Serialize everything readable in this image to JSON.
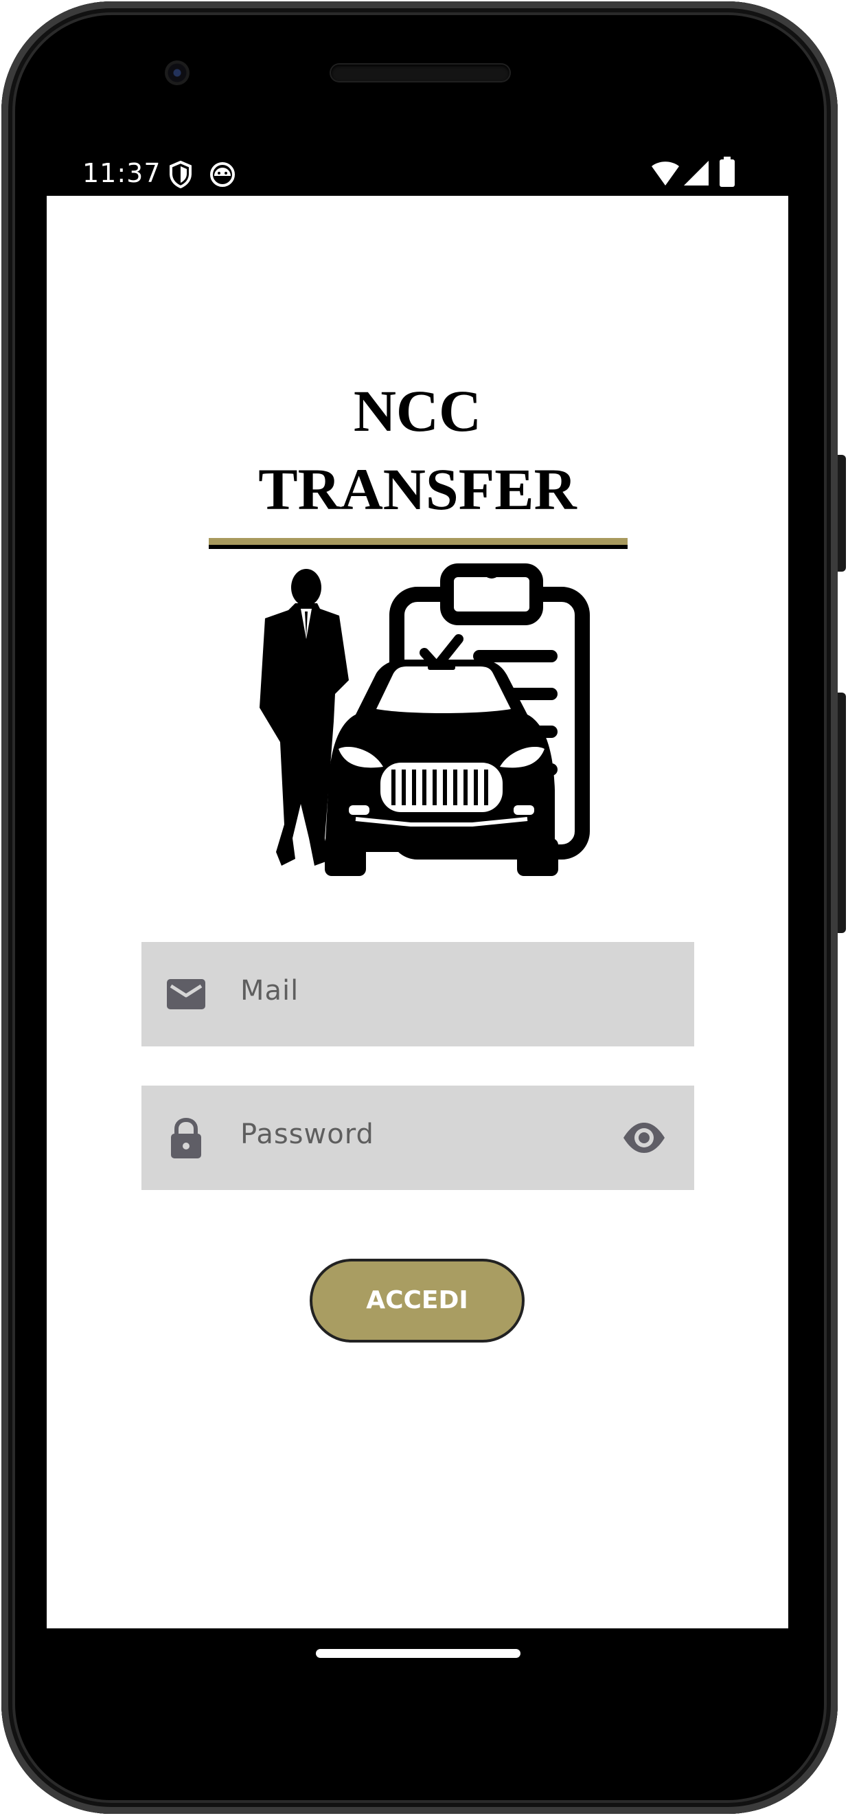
{
  "status_bar": {
    "time": "11:37",
    "left_icons": [
      "shield-icon",
      "android-notification-icon"
    ],
    "right_icons": [
      "wifi-icon",
      "cellular-signal-icon",
      "battery-icon"
    ]
  },
  "logo": {
    "line1": "NCC",
    "line2": "TRANSFER",
    "accent_color": "#a89a5e",
    "illustration": "chauffeur-with-car-and-checklist-illustration"
  },
  "form": {
    "mail": {
      "icon": "mail-icon",
      "placeholder": "Mail"
    },
    "password": {
      "icon": "lock-icon",
      "placeholder": "Password",
      "toggle_icon": "eye-icon"
    },
    "submit_label": "ACCEDI",
    "submit_color": "#a99d62",
    "field_background": "#d6d6d6"
  }
}
